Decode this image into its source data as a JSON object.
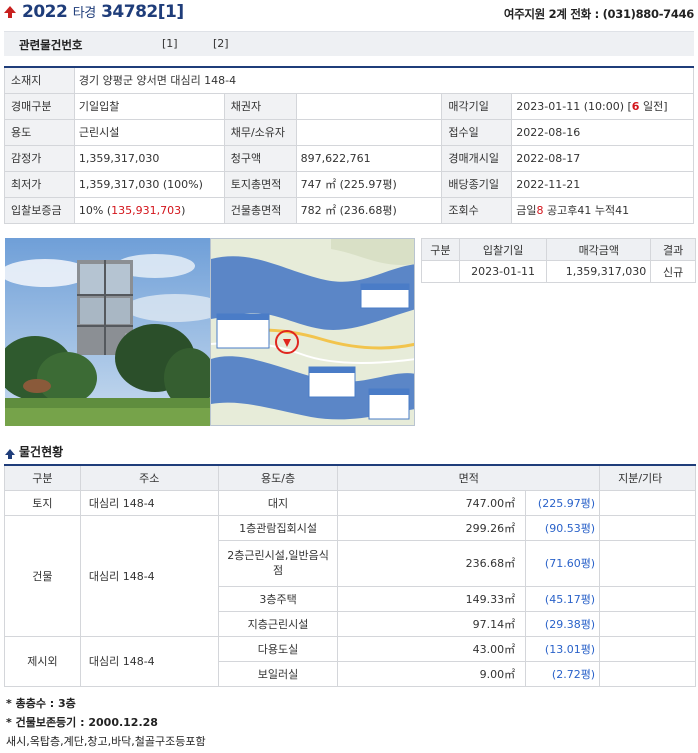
{
  "header": {
    "case_year": "2022",
    "case_type": "타경",
    "case_number": "34782[1]",
    "contact": "여주지원 2계 전화 : (031)880-7446"
  },
  "related": {
    "label": "관련물건번호",
    "links": [
      "[1]",
      "[2]"
    ]
  },
  "info": {
    "location_label": "소재지",
    "location": "경기 양평군 양서면 대심리 148-4",
    "rows": [
      {
        "l1": "경매구분",
        "v1": "기일입찰",
        "l2": "채권자",
        "v2": "",
        "l3": "매각기일",
        "v3a": "2023-01-11 (10:00) [",
        "v3b": "6",
        "v3c": " 일전]"
      },
      {
        "l1": "용도",
        "v1": "근린시설",
        "l2": "채무/소유자",
        "v2": "",
        "l3": "접수일",
        "v3": "2022-08-16"
      },
      {
        "l1": "감정가",
        "v1": "1,359,317,030",
        "l2": "청구액",
        "v2": "897,622,761",
        "l3": "경매개시일",
        "v3": "2022-08-17"
      },
      {
        "l1": "최저가",
        "v1": "1,359,317,030 (100%)",
        "l2": "토지총면적",
        "v2": "747 ㎡ (225.97평)",
        "l3": "배당종기일",
        "v3": "2022-11-21"
      },
      {
        "l1": "입찰보증금",
        "v1a": "10% (",
        "v1b": "135,931,703",
        "v1c": ")",
        "l2": "건물총면적",
        "v2": "782 ㎡ (236.68평)",
        "l3": "조회수",
        "v3a": "금일",
        "v3b": "8",
        "v3c": " 공고후41 누적41"
      }
    ]
  },
  "history": {
    "headers": [
      "구분",
      "입찰기일",
      "매각금액",
      "결과"
    ],
    "rows": [
      {
        "type": "",
        "date": "2023-01-11",
        "amount": "1,359,317,030",
        "result": "신규"
      }
    ]
  },
  "goods": {
    "title": "물건현황",
    "headers": [
      "구분",
      "주소",
      "용도/층",
      "면적",
      "지분/기타"
    ],
    "land": {
      "type": "토지",
      "address": "대심리 148-4",
      "use": "대지",
      "area": "747.00㎡",
      "py": "(225.97평)"
    },
    "building": {
      "type": "건물",
      "address": "대심리 148-4",
      "rows": [
        {
          "use": "1층관람집회시설",
          "area": "299.26㎡",
          "py": "(90.53평)"
        },
        {
          "use": "2층근린시설,일반음식점",
          "area": "236.68㎡",
          "py": "(71.60평)"
        },
        {
          "use": "3층주택",
          "area": "149.33㎡",
          "py": "(45.17평)"
        },
        {
          "use": "지층근린시설",
          "area": "97.14㎡",
          "py": "(29.38평)"
        }
      ]
    },
    "excluded": {
      "type": "제시외",
      "address": "대심리 148-4",
      "rows": [
        {
          "use": "다용도실",
          "area": "43.00㎡",
          "py": "(13.01평)"
        },
        {
          "use": "보일러실",
          "area": "9.00㎡",
          "py": "(2.72평)"
        }
      ]
    }
  },
  "notes": {
    "floors": "* 총층수 : 3층",
    "registration": "* 건물보존등기 : 2000.12.28",
    "structure": "새시,옥탑층,계단,창고,바닥,철골구조등포함"
  }
}
